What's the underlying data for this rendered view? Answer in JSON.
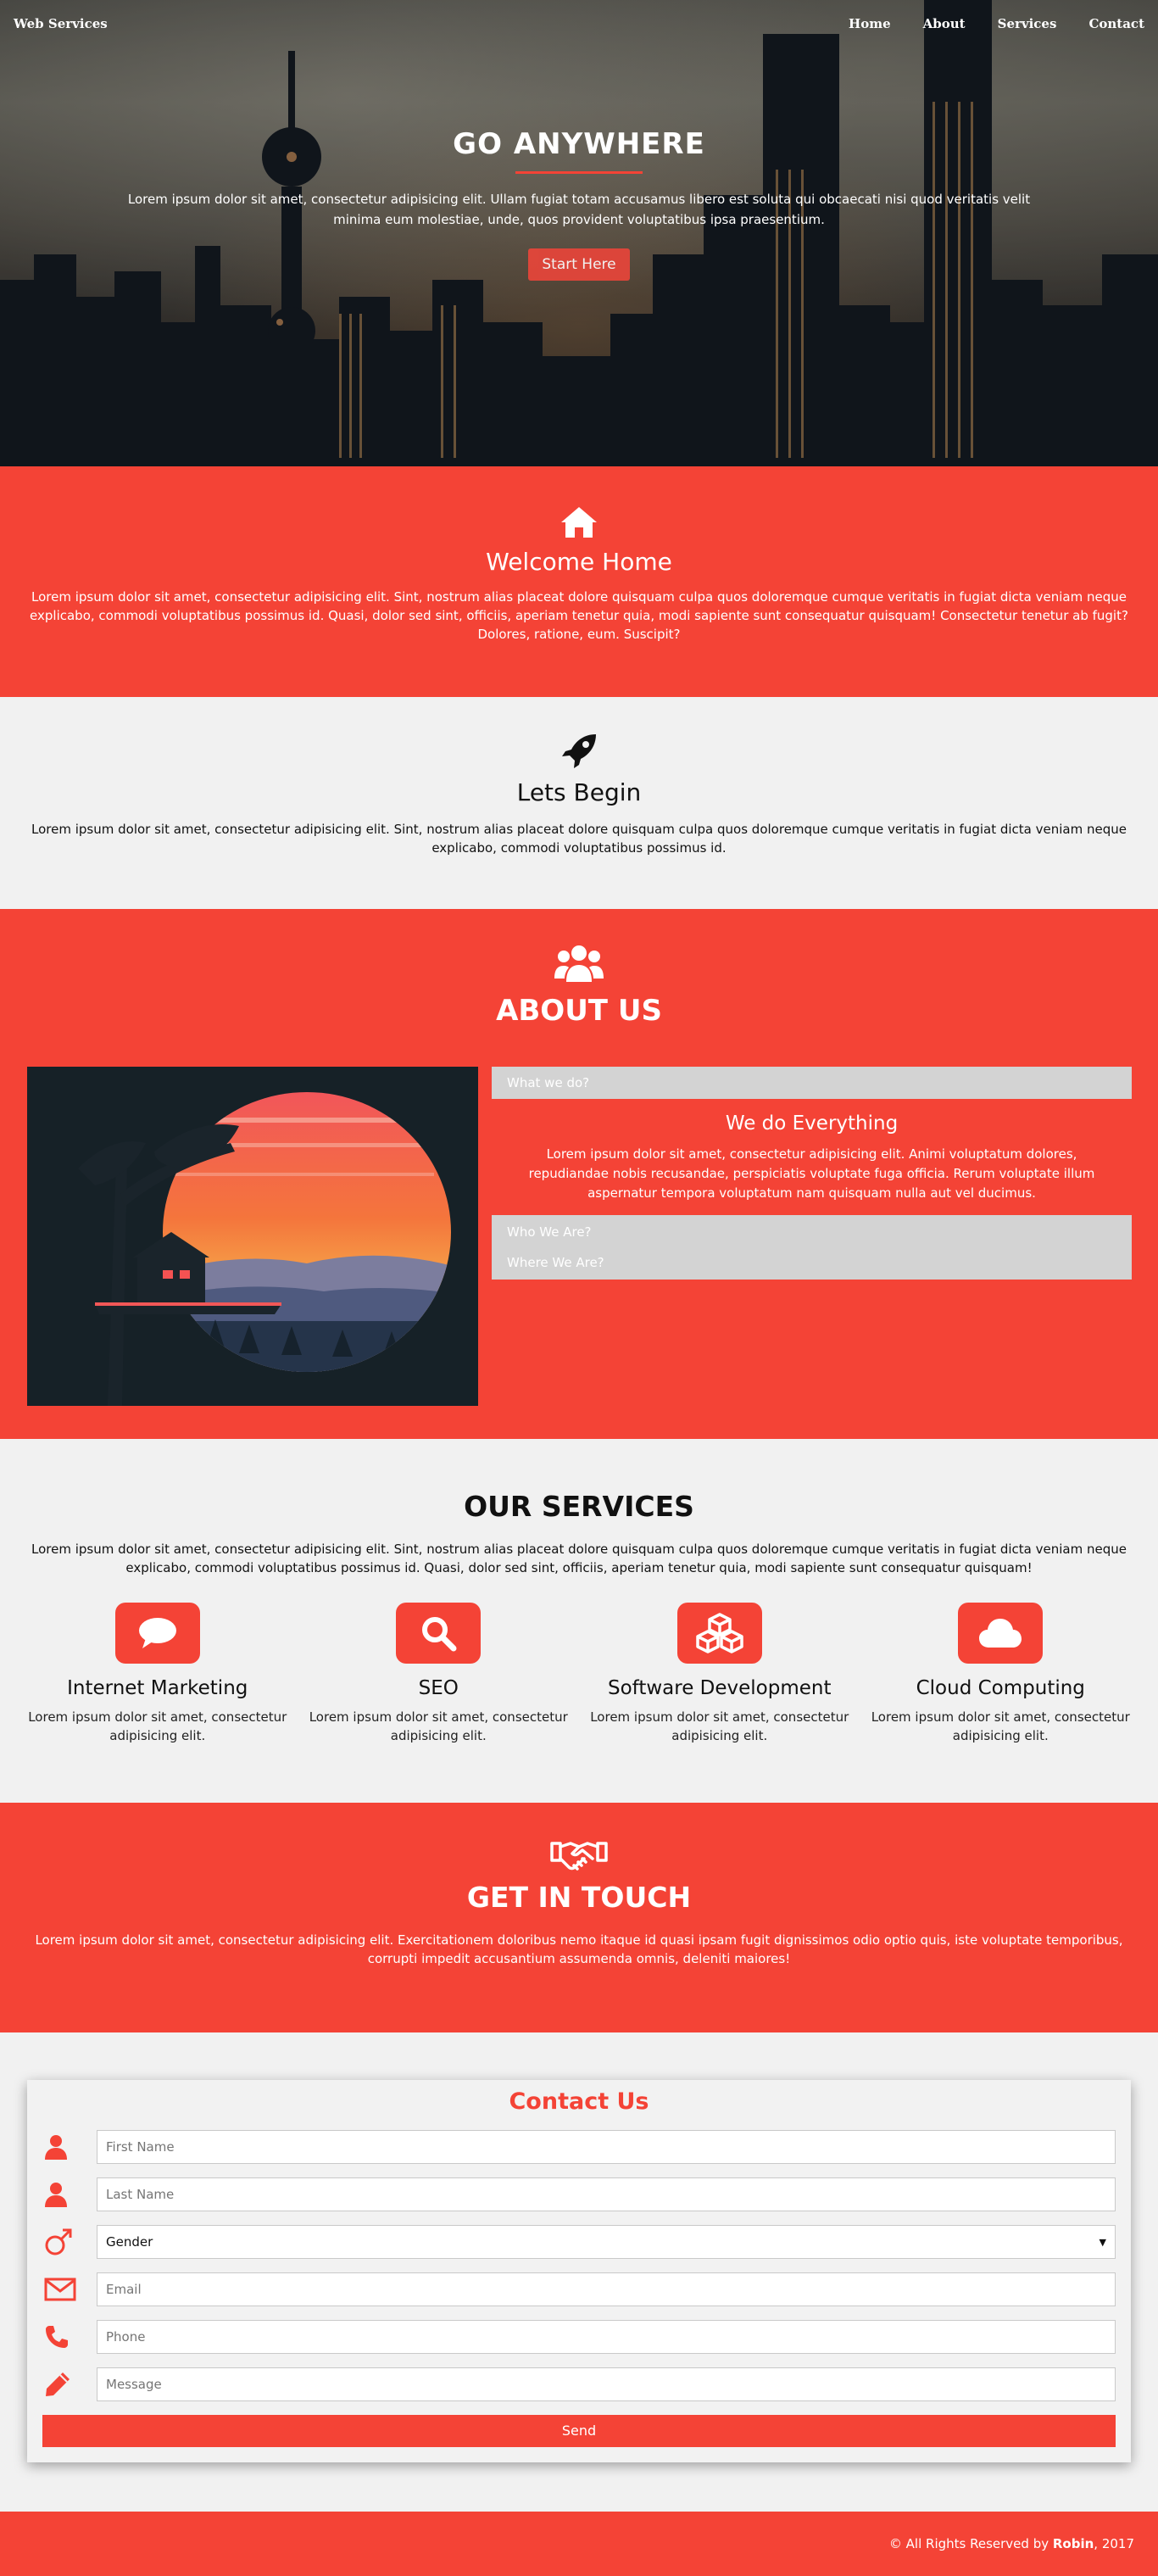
{
  "nav": {
    "brand": "Web Services",
    "links": [
      "Home",
      "About",
      "Services",
      "Contact"
    ]
  },
  "hero": {
    "title": "GO ANYWHERE",
    "text": "Lorem ipsum dolor sit amet, consectetur adipisicing elit. Ullam fugiat totam accusamus libero est soluta qui obcaecati nisi quod veritatis velit minima eum molestiae, unde, quos provident voluptatibus ipsa praesentium.",
    "button": "Start Here"
  },
  "welcome": {
    "icon": "home-icon",
    "title": "Welcome Home",
    "text": "Lorem ipsum dolor sit amet, consectetur adipisicing elit. Sint, nostrum alias placeat dolore quisquam culpa quos doloremque cumque veritatis in fugiat dicta veniam neque explicabo, commodi voluptatibus possimus id. Quasi, dolor sed sint, officiis, aperiam tenetur quia, modi sapiente sunt consequatur quisquam! Consectetur tenetur ab fugit? Dolores, ratione, eum. Suscipit?"
  },
  "begin": {
    "icon": "rocket-icon",
    "title": "Lets Begin",
    "text": "Lorem ipsum dolor sit amet, consectetur adipisicing elit. Sint, nostrum alias placeat dolore quisquam culpa quos doloremque cumque veritatis in fugiat dicta veniam neque explicabo, commodi voluptatibus possimus id."
  },
  "about": {
    "icon": "users-icon",
    "title": "ABOUT US",
    "accordion": {
      "first": "What we do?",
      "body_title": "We do Everything",
      "body_text": "Lorem ipsum dolor sit amet, consectetur adipisicing elit. Animi voluptatum dolores, repudiandae nobis recusandae, perspiciatis voluptate fuga officia. Rerum voluptate illum aspernatur tempora voluptatum nam quisquam nulla aut vel ducimus.",
      "second": "Who We Are?",
      "third": "Where We Are?"
    }
  },
  "services": {
    "title": "OUR SERVICES",
    "text": "Lorem ipsum dolor sit amet, consectetur adipisicing elit. Sint, nostrum alias placeat dolore quisquam culpa quos doloremque cumque veritatis in fugiat dicta veniam neque explicabo, commodi voluptatibus possimus id. Quasi, dolor sed sint, officiis, aperiam tenetur quia, modi sapiente sunt consequatur quisquam!",
    "items": [
      {
        "icon": "chat-icon",
        "title": "Internet Marketing",
        "text": "Lorem ipsum dolor sit amet, consectetur adipisicing elit."
      },
      {
        "icon": "search-icon",
        "title": "SEO",
        "text": "Lorem ipsum dolor sit amet, consectetur adipisicing elit."
      },
      {
        "icon": "cubes-icon",
        "title": "Software Development",
        "text": "Lorem ipsum dolor sit amet, consectetur adipisicing elit."
      },
      {
        "icon": "cloud-icon",
        "title": "Cloud Computing",
        "text": "Lorem ipsum dolor sit amet, consectetur adipisicing elit."
      }
    ]
  },
  "touch": {
    "icon": "handshake-icon",
    "title": "GET IN TOUCH",
    "text": "Lorem ipsum dolor sit amet, consectetur adipisicing elit. Exercitationem doloribus nemo itaque id quasi ipsam fugit dignissimos odio optio quis, iste voluptate temporibus, corrupti impedit accusantium assumenda omnis, deleniti maiores!"
  },
  "contact": {
    "title": "Contact Us",
    "first_name_placeholder": "First Name",
    "last_name_placeholder": "Last Name",
    "gender_value": "Gender",
    "email_placeholder": "Email",
    "phone_placeholder": "Phone",
    "message_placeholder": "Message",
    "send": "Send"
  },
  "footer": {
    "prefix": "© All Rights Reserved by ",
    "author": "Robin",
    "suffix": ", 2017"
  },
  "colors": {
    "accent": "#f44336",
    "light_bg": "#f1f1f1",
    "accordion_gray": "#d3d3d3"
  }
}
